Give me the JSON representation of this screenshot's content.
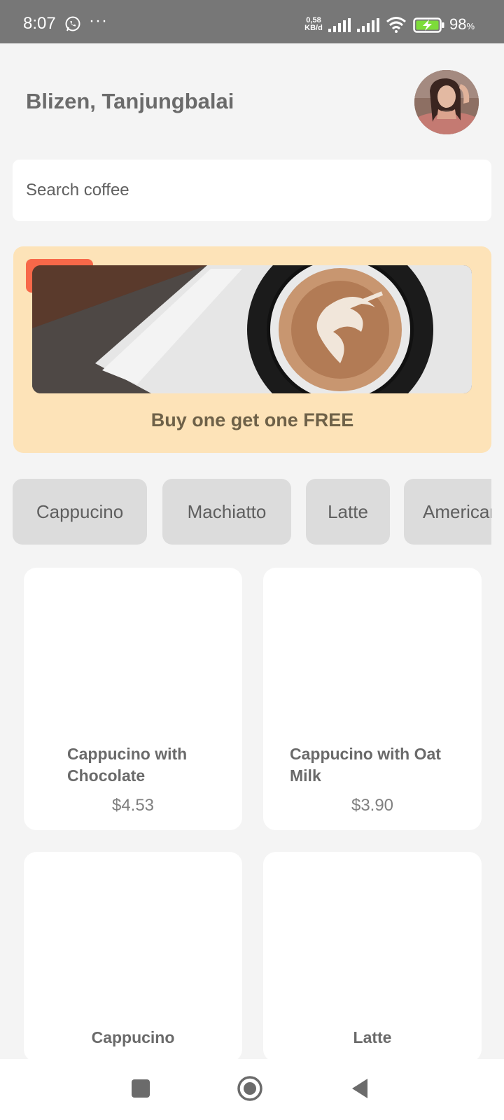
{
  "status_bar": {
    "time": "8:07",
    "more": "···",
    "speed_value": "0,58",
    "speed_unit": "KB/d",
    "battery_percent": "98",
    "battery_unit": "%",
    "icons": [
      "whatsapp-icon",
      "signal-icon",
      "wifi-icon",
      "battery-charging-icon"
    ]
  },
  "header": {
    "location": "Blizen, Tanjungbalai"
  },
  "search": {
    "placeholder": "Search coffee"
  },
  "promo": {
    "text": "Buy one get one FREE",
    "background": "#fde3b8",
    "tag_color": "#f76849"
  },
  "categories": [
    {
      "label": "Cappucino"
    },
    {
      "label": "Machiatto"
    },
    {
      "label": "Latte"
    },
    {
      "label": "Americano"
    }
  ],
  "products": [
    {
      "name": "Cappucino with Chocolate",
      "price": "$4.53"
    },
    {
      "name": "Cappucino with Oat Milk",
      "price": "$3.90"
    },
    {
      "name": "Cappucino",
      "price": ""
    },
    {
      "name": "Latte",
      "price": ""
    }
  ],
  "nav": {
    "icons": [
      "recent-apps-icon",
      "home-icon",
      "back-icon"
    ]
  }
}
